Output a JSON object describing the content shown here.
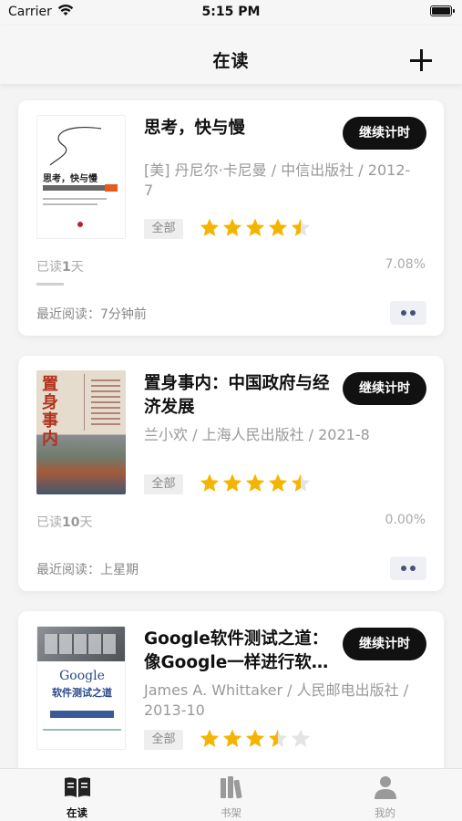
{
  "status_bar": {
    "carrier": "Carrier",
    "time": "5:15 PM"
  },
  "nav": {
    "title": "在读"
  },
  "books": [
    {
      "title": "思考，快与慢",
      "meta": "[美] 丹尼尔·卡尼曼  / 中信出版社 / 2012-7",
      "timer_label": "继续计时",
      "tag": "全部",
      "rating": 4.5,
      "read_days_prefix": "已读",
      "read_days_value": "1",
      "read_days_suffix": "天",
      "percent": "7.08%",
      "progress": 0.0708,
      "last_read": "最近阅读：7分钟前",
      "cover_text": "思考，快与慢"
    },
    {
      "title": "置身事内：中国政府与经济发展",
      "meta": "兰小欢  / 上海人民出版社 / 2021-8",
      "timer_label": "继续计时",
      "tag": "全部",
      "rating": 4.5,
      "read_days_prefix": "已读",
      "read_days_value": "10",
      "read_days_suffix": "天",
      "percent": "0.00%",
      "progress": 0,
      "last_read": "最近阅读：上星期",
      "cover_text": "置身事内"
    },
    {
      "title": "Google软件测试之道：像Google一样进行软件测试",
      "meta": "James A. Whittaker  / 人民邮电出版社 / 2013-10",
      "timer_label": "继续计时",
      "tag": "全部",
      "rating": 3.5,
      "cover_text": "Google",
      "cover_text_cn": "软件测试之道"
    }
  ],
  "tabs": [
    {
      "label": "在读",
      "icon": "book-open-icon",
      "active": true
    },
    {
      "label": "书架",
      "icon": "bookshelf-icon",
      "active": false
    },
    {
      "label": "我的",
      "icon": "person-icon",
      "active": false
    }
  ],
  "colors": {
    "star": "#f5b400",
    "star_empty": "#e4e4e4",
    "accent": "#111111"
  }
}
